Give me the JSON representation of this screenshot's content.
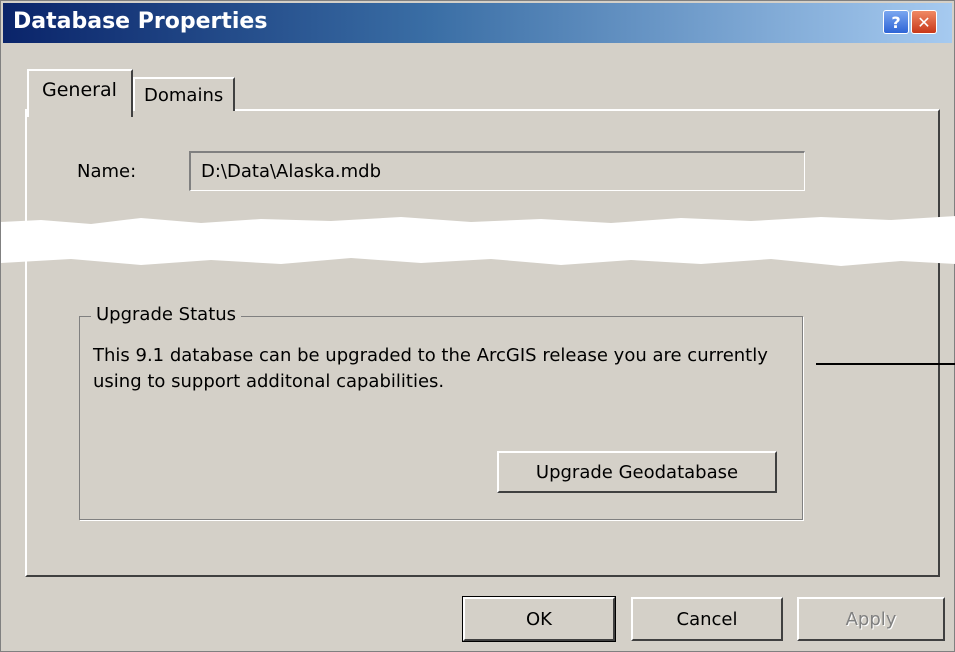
{
  "window": {
    "title": "Database Properties"
  },
  "title_buttons": {
    "help_glyph": "?",
    "close_glyph": "✕"
  },
  "tabs": [
    {
      "label": "General",
      "selected": true
    },
    {
      "label": "Domains",
      "selected": false
    }
  ],
  "general": {
    "name_label": "Name:",
    "name_value": "D:\\Data\\Alaska.mdb"
  },
  "upgrade_status": {
    "title": "Upgrade Status",
    "message": "This 9.1 database can be upgraded to the ArcGIS release you are currently using to support additonal capabilities.",
    "button_label": "Upgrade Geodatabase"
  },
  "footer": {
    "ok_label": "OK",
    "cancel_label": "Cancel",
    "apply_label": "Apply"
  },
  "colors": {
    "dialog_face": "#d4d0c8",
    "title_start": "#0a246a",
    "title_end": "#a6caf0",
    "disabled_text": "#808080"
  }
}
